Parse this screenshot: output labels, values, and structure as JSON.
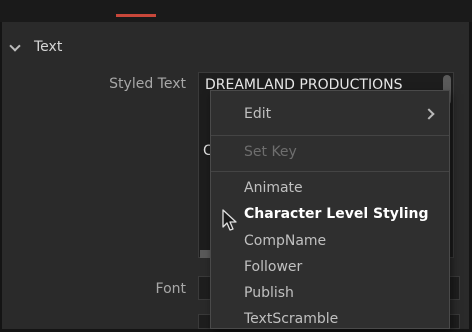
{
  "section": {
    "title": "Text"
  },
  "fields": {
    "styled_text_label": "Styled Text",
    "styled_text_value": "DREAMLAND PRODUCTIONS",
    "peek_char": "C",
    "font_label": "Font"
  },
  "context_menu": {
    "items": [
      {
        "label": "Edit",
        "enabled": true,
        "submenu": true
      },
      {
        "label": "Set Key",
        "enabled": false
      },
      {
        "label": "Animate",
        "enabled": true
      },
      {
        "label": "Character Level Styling",
        "enabled": true,
        "hovered": true
      },
      {
        "label": "CompName",
        "enabled": true
      },
      {
        "label": "Follower",
        "enabled": true
      },
      {
        "label": "Publish",
        "enabled": true
      },
      {
        "label": "TextScramble",
        "enabled": true
      }
    ]
  },
  "colors": {
    "accent": "#c8473a",
    "panel_bg": "#2a2a2a",
    "menu_bg": "#2f2f2f"
  }
}
